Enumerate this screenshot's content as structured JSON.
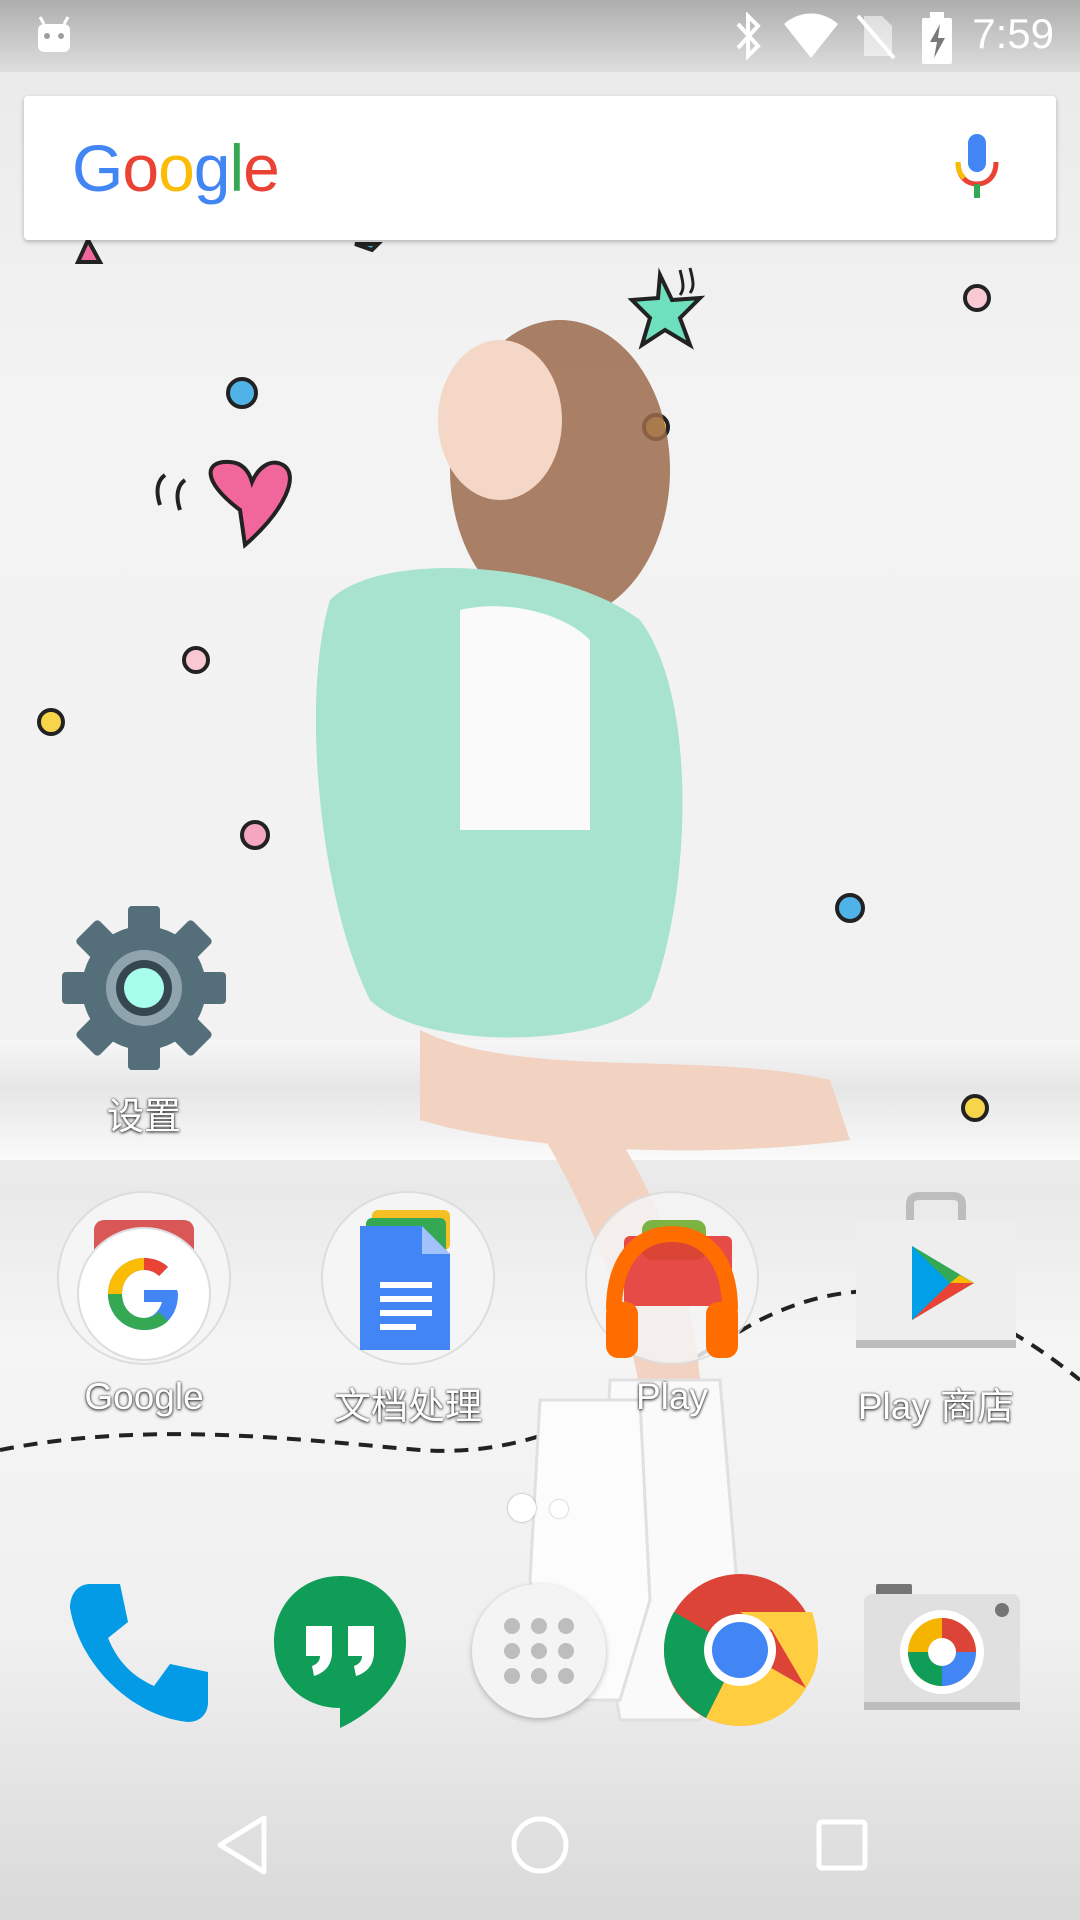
{
  "status_bar": {
    "time": "7:59",
    "icons": [
      "android-debug-icon",
      "bluetooth-icon",
      "wifi-icon",
      "no-sim-icon",
      "battery-charging-icon"
    ]
  },
  "search_bar": {
    "logo_letters": [
      "G",
      "o",
      "o",
      "g",
      "l",
      "e"
    ],
    "logo_colors": [
      "#4285F4",
      "#EA4335",
      "#FBBC05",
      "#4285F4",
      "#34A853",
      "#EA4335"
    ],
    "mic_icon": "mic-icon"
  },
  "home": {
    "settings": {
      "label": "设置",
      "icon": "settings-gear-icon"
    },
    "apps": [
      {
        "label": "Google",
        "icon": "google-folder-icon"
      },
      {
        "label": "文档处理",
        "icon": "docs-folder-icon"
      },
      {
        "label": "Play",
        "icon": "play-music-folder-icon"
      },
      {
        "label": "Play 商店",
        "icon": "play-store-icon"
      }
    ],
    "page_indicator": {
      "pages": 2,
      "current": 1
    }
  },
  "dock": {
    "items": [
      "phone-icon",
      "hangouts-icon",
      "app-drawer-icon",
      "chrome-icon",
      "camera-icon"
    ]
  },
  "nav_bar": {
    "buttons": [
      "back-icon",
      "home-icon",
      "recents-icon"
    ]
  },
  "colors": {
    "settings_gear": "#546E7A",
    "settings_center": "#A7FFEB",
    "docs_blue": "#4285F4",
    "play_music_orange": "#FF6D00",
    "hangouts_green": "#0F9D58",
    "phone_blue": "#039BE5"
  }
}
